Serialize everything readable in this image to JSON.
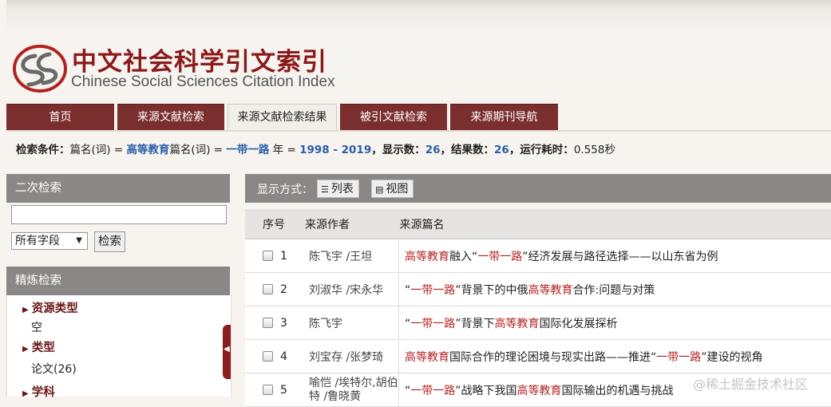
{
  "header": {
    "logo_cn": "中文社会科学引文索引",
    "logo_en": "Chinese Social Sciences Citation Index"
  },
  "nav": {
    "tabs": [
      {
        "label": "首页",
        "active": false
      },
      {
        "label": "来源文献检索",
        "active": false
      },
      {
        "label": "来源文献检索结果",
        "active": true
      },
      {
        "label": "被引文献检索",
        "active": false
      },
      {
        "label": "来源期刊导航",
        "active": false
      }
    ]
  },
  "conditions": {
    "label": "检索条件：",
    "part1": "篇名(词) = ",
    "kw1": "高等教育",
    "part2": "篇名(词) = ",
    "kw2": "一带一路",
    "part3": " 年 = ",
    "years": "1998 - 2019",
    "display_label": "，显示数：",
    "display_value": "26",
    "results_label": "，结果数：",
    "results_value": "26",
    "time_label": "，运行耗时：",
    "time_value": "0.558秒"
  },
  "secondary_search": {
    "title": "二次检索",
    "field_value": "所有字段",
    "button": "检索"
  },
  "refine": {
    "title": "精炼检索",
    "facets": [
      {
        "name": "资源类型",
        "values": [
          "空"
        ]
      },
      {
        "name": "类型",
        "values": [
          "论文(26)"
        ]
      },
      {
        "name": "学科",
        "values": []
      }
    ]
  },
  "view_bar": {
    "label": "显示方式：",
    "list_btn": "列表",
    "view_btn": "视图"
  },
  "table": {
    "headers": [
      "序号",
      "来源作者",
      "来源篇名"
    ],
    "rows": [
      {
        "no": "1",
        "author": "陈飞宇 /王坦",
        "title": [
          [
            "高等教育",
            true
          ],
          [
            "融入“",
            false
          ],
          [
            "一带一路",
            true
          ],
          [
            "”经济发展与路径选择——以山东省为例",
            false
          ]
        ]
      },
      {
        "no": "2",
        "author": "刘淑华 /宋永华",
        "title": [
          [
            "“",
            false
          ],
          [
            "一带一路",
            true
          ],
          [
            "”背景下的中俄",
            false
          ],
          [
            "高等教育",
            true
          ],
          [
            "合作:问题与对策",
            false
          ]
        ]
      },
      {
        "no": "3",
        "author": "陈飞宇",
        "title": [
          [
            "“",
            false
          ],
          [
            "一带一路",
            true
          ],
          [
            "”背景下",
            false
          ],
          [
            "高等教育",
            true
          ],
          [
            "国际化发展探析",
            false
          ]
        ]
      },
      {
        "no": "4",
        "author": "刘宝存 /张梦琦",
        "title": [
          [
            "高等教育",
            true
          ],
          [
            "国际合作的理论困境与现实出路——推进“",
            false
          ],
          [
            "一带一路",
            true
          ],
          [
            "”建设的视角",
            false
          ]
        ]
      },
      {
        "no": "5",
        "author": "喻恺 /埃特尔,胡伯特 /鲁晓黄",
        "title": [
          [
            "“",
            false
          ],
          [
            "一带一路",
            true
          ],
          [
            "”战略下我国",
            false
          ],
          [
            "高等教育",
            true
          ],
          [
            "国际输出的机遇与挑战",
            false
          ]
        ]
      }
    ]
  },
  "watermark": "@稀土掘金技术社区",
  "colors": {
    "accent": "#7a2e2e",
    "highlight": "#b41f1f",
    "blue": "#2a5ea8",
    "panel": "#8a8886"
  }
}
